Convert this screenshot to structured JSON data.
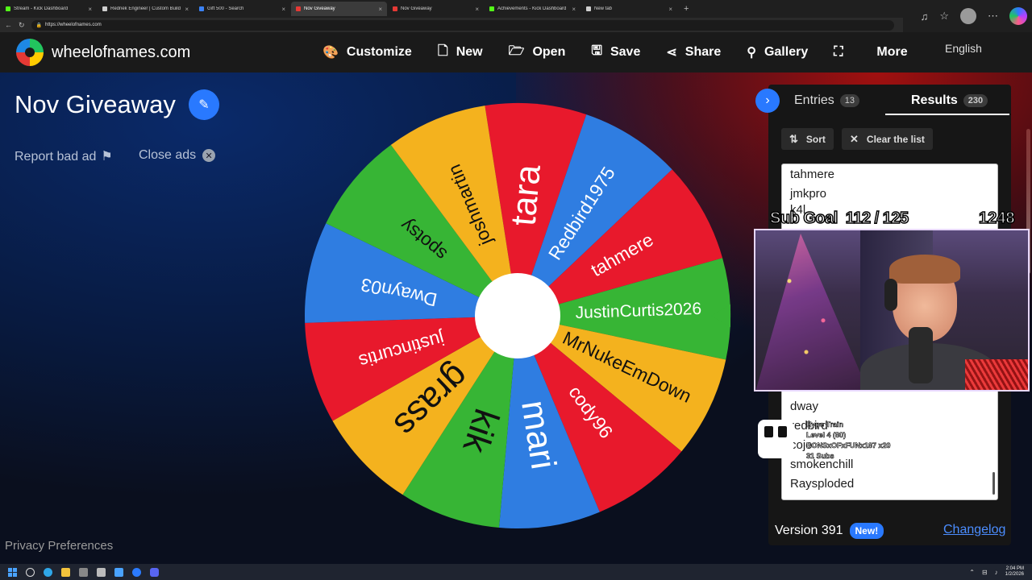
{
  "browser": {
    "tabs": [
      {
        "title": "Stream - Kick Dashboard",
        "color": "#53fc18",
        "active": false
      },
      {
        "title": "Rednek Engineer | Custom Build P...",
        "color": "#cfcfcf",
        "active": false
      },
      {
        "title": "Gift 500 - Search",
        "color": "#3b82f6",
        "active": false
      },
      {
        "title": "Nov Giveaway",
        "color": "#e53935",
        "active": true
      },
      {
        "title": "Nov Giveaway",
        "color": "#e53935",
        "active": false
      },
      {
        "title": "Achievements - Kick Dashboard",
        "color": "#53fc18",
        "active": false
      },
      {
        "title": "New tab",
        "color": "#cfcfcf",
        "active": false
      }
    ],
    "url": "https://wheelofnames.com",
    "close_glyph": "×",
    "new_tab_glyph": "+"
  },
  "header": {
    "site_name": "wheelofnames.com",
    "menu": [
      {
        "label": "Customize",
        "icon": "palette-icon",
        "glyph": "🎨"
      },
      {
        "label": "New",
        "icon": "file-icon",
        "glyph": "🗋"
      },
      {
        "label": "Open",
        "icon": "folder-icon",
        "glyph": "🗁"
      },
      {
        "label": "Save",
        "icon": "save-icon",
        "glyph": "🖫"
      },
      {
        "label": "Share",
        "icon": "share-icon",
        "glyph": "⋖"
      },
      {
        "label": "Gallery",
        "icon": "search-icon",
        "glyph": "⚲"
      },
      {
        "label": "",
        "icon": "fullscreen-icon",
        "glyph": "⛶"
      },
      {
        "label": "More",
        "icon": "more-icon",
        "glyph": ""
      }
    ],
    "language": "English"
  },
  "left": {
    "title": "Nov Giveaway",
    "report_bad_ad": "Report bad ad",
    "close_ads": "Close ads",
    "privacy": "Privacy Preferences"
  },
  "wheel": {
    "segments": [
      {
        "name": "tara",
        "color": "#e8192c"
      },
      {
        "name": "Redbird1975",
        "color": "#2f7de1"
      },
      {
        "name": "tahmere",
        "color": "#e8192c"
      },
      {
        "name": "JustinCurtis2026",
        "color": "#37b535"
      },
      {
        "name": "MrNukeEmDown",
        "color": "#f4b21e"
      },
      {
        "name": "cody96",
        "color": "#e8192c"
      },
      {
        "name": "mari",
        "color": "#2f7de1"
      },
      {
        "name": "kik",
        "color": "#37b535"
      },
      {
        "name": "grass",
        "color": "#f4b21e"
      },
      {
        "name": "justincurtis",
        "color": "#e8192c"
      },
      {
        "name": "Dwayn03",
        "color": "#2f7de1"
      },
      {
        "name": "spotsy",
        "color": "#37b535"
      },
      {
        "name": "joshmartin",
        "color": "#f4b21e"
      }
    ],
    "pointer_color": "#37b535"
  },
  "panel": {
    "entries_label": "Entries",
    "entries_count": "13",
    "results_label": "Results",
    "results_count": "230",
    "sort_label": "Sort",
    "clear_label": "Clear the list",
    "results": [
      "tahmere",
      "jmkpro",
      "k4l",
      "dway",
      "redbird",
      "cojo",
      "smokenchill",
      "Raysploded"
    ],
    "version": "Version 391",
    "new_badge": "New!",
    "changelog": "Changelog"
  },
  "overlay": {
    "sub_goal_label": "Sub Goal",
    "sub_goal_value": "112 / 125",
    "total": "1248",
    "hype_train_lines": [
      "Hype Train",
      "Level 4  (80)",
      "BONSxOFxFUNx187 x20",
      "31 Subs"
    ]
  },
  "taskbar": {
    "time": "2:04 PM",
    "date": "1/2/2026"
  }
}
